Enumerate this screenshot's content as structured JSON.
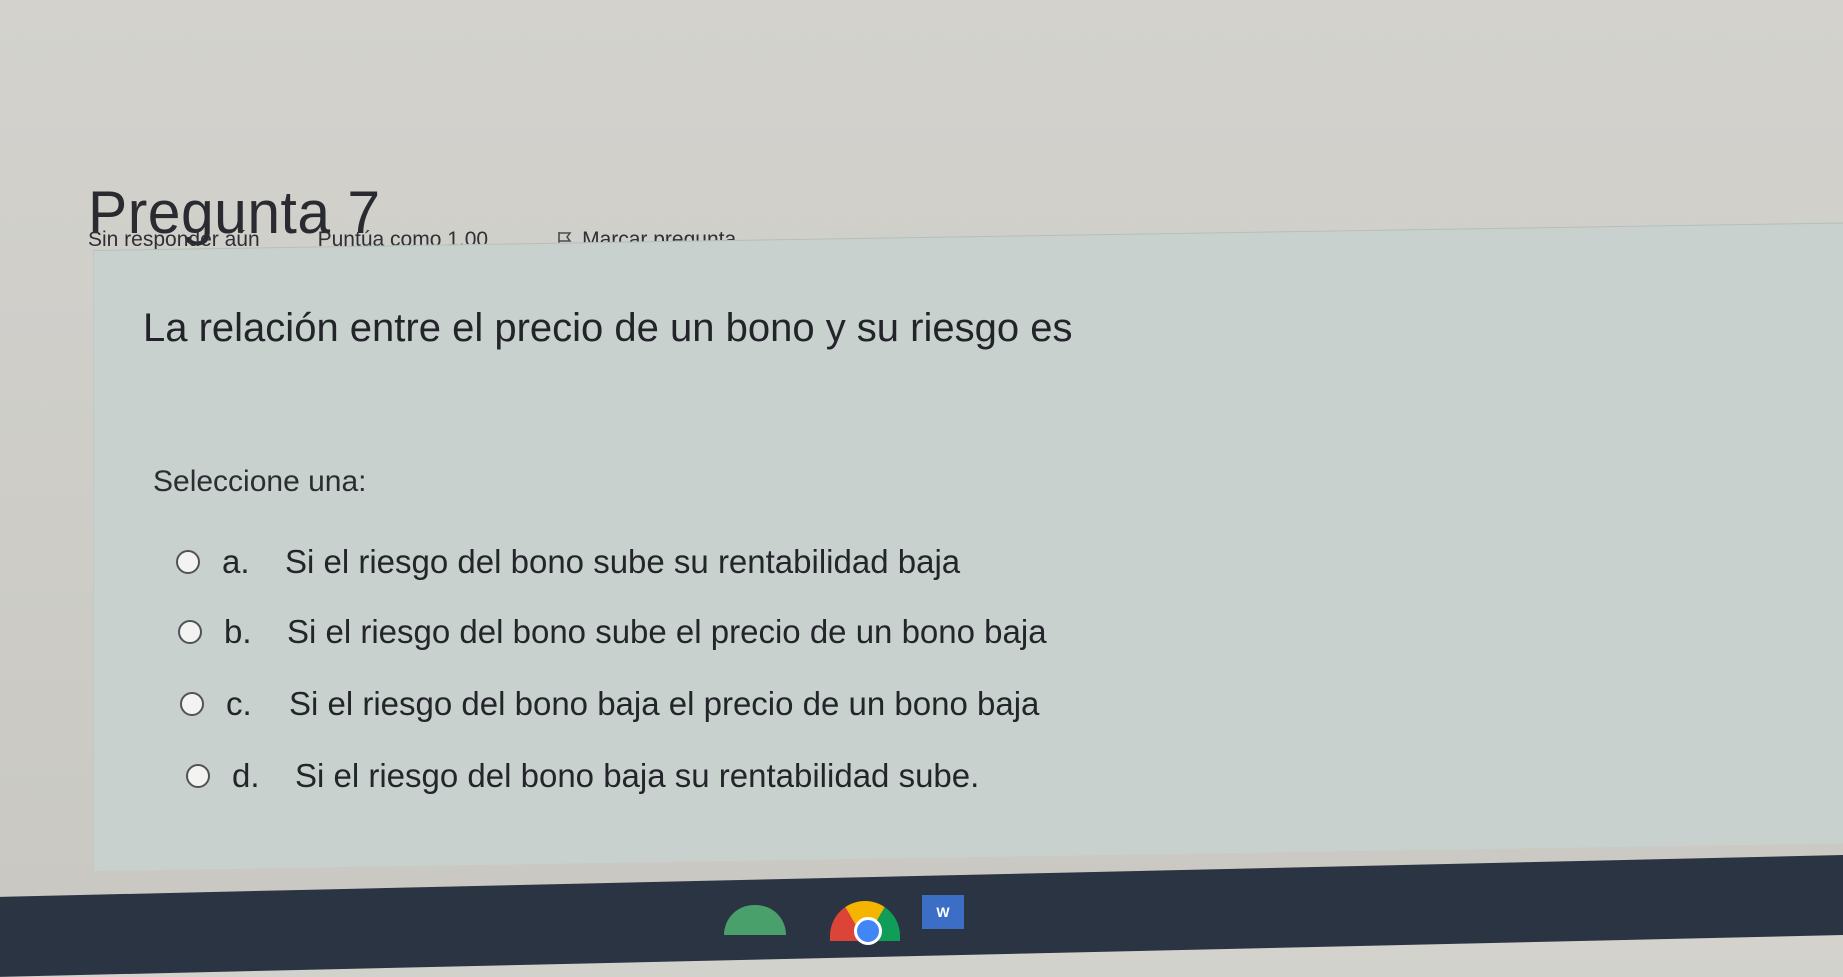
{
  "question": {
    "title": "Pregunta 7",
    "status": "Sin responder aún",
    "grade": "Puntúa como 1,00",
    "flag_label": "Marcar pregunta",
    "text": "La relación entre el precio de un bono y su riesgo es",
    "prompt": "Seleccione una:",
    "answers": [
      {
        "letter": "a.",
        "text": "Si el riesgo del bono sube su rentabilidad baja"
      },
      {
        "letter": "b.",
        "text": "Si el riesgo del bono sube el precio de un bono baja"
      },
      {
        "letter": "c.",
        "text": "Si el riesgo del bono baja el precio de un bono baja"
      },
      {
        "letter": "d.",
        "text": "Si el riesgo del bono baja su rentabilidad sube."
      }
    ]
  },
  "taskbar": {
    "icons": [
      "app-icon",
      "chrome-icon",
      "word-icon"
    ],
    "word_glyph": "W"
  },
  "colors": {
    "question_background": "#c8d1cd",
    "page_background": "#d3d2cd",
    "taskbar": "#2a3442"
  }
}
